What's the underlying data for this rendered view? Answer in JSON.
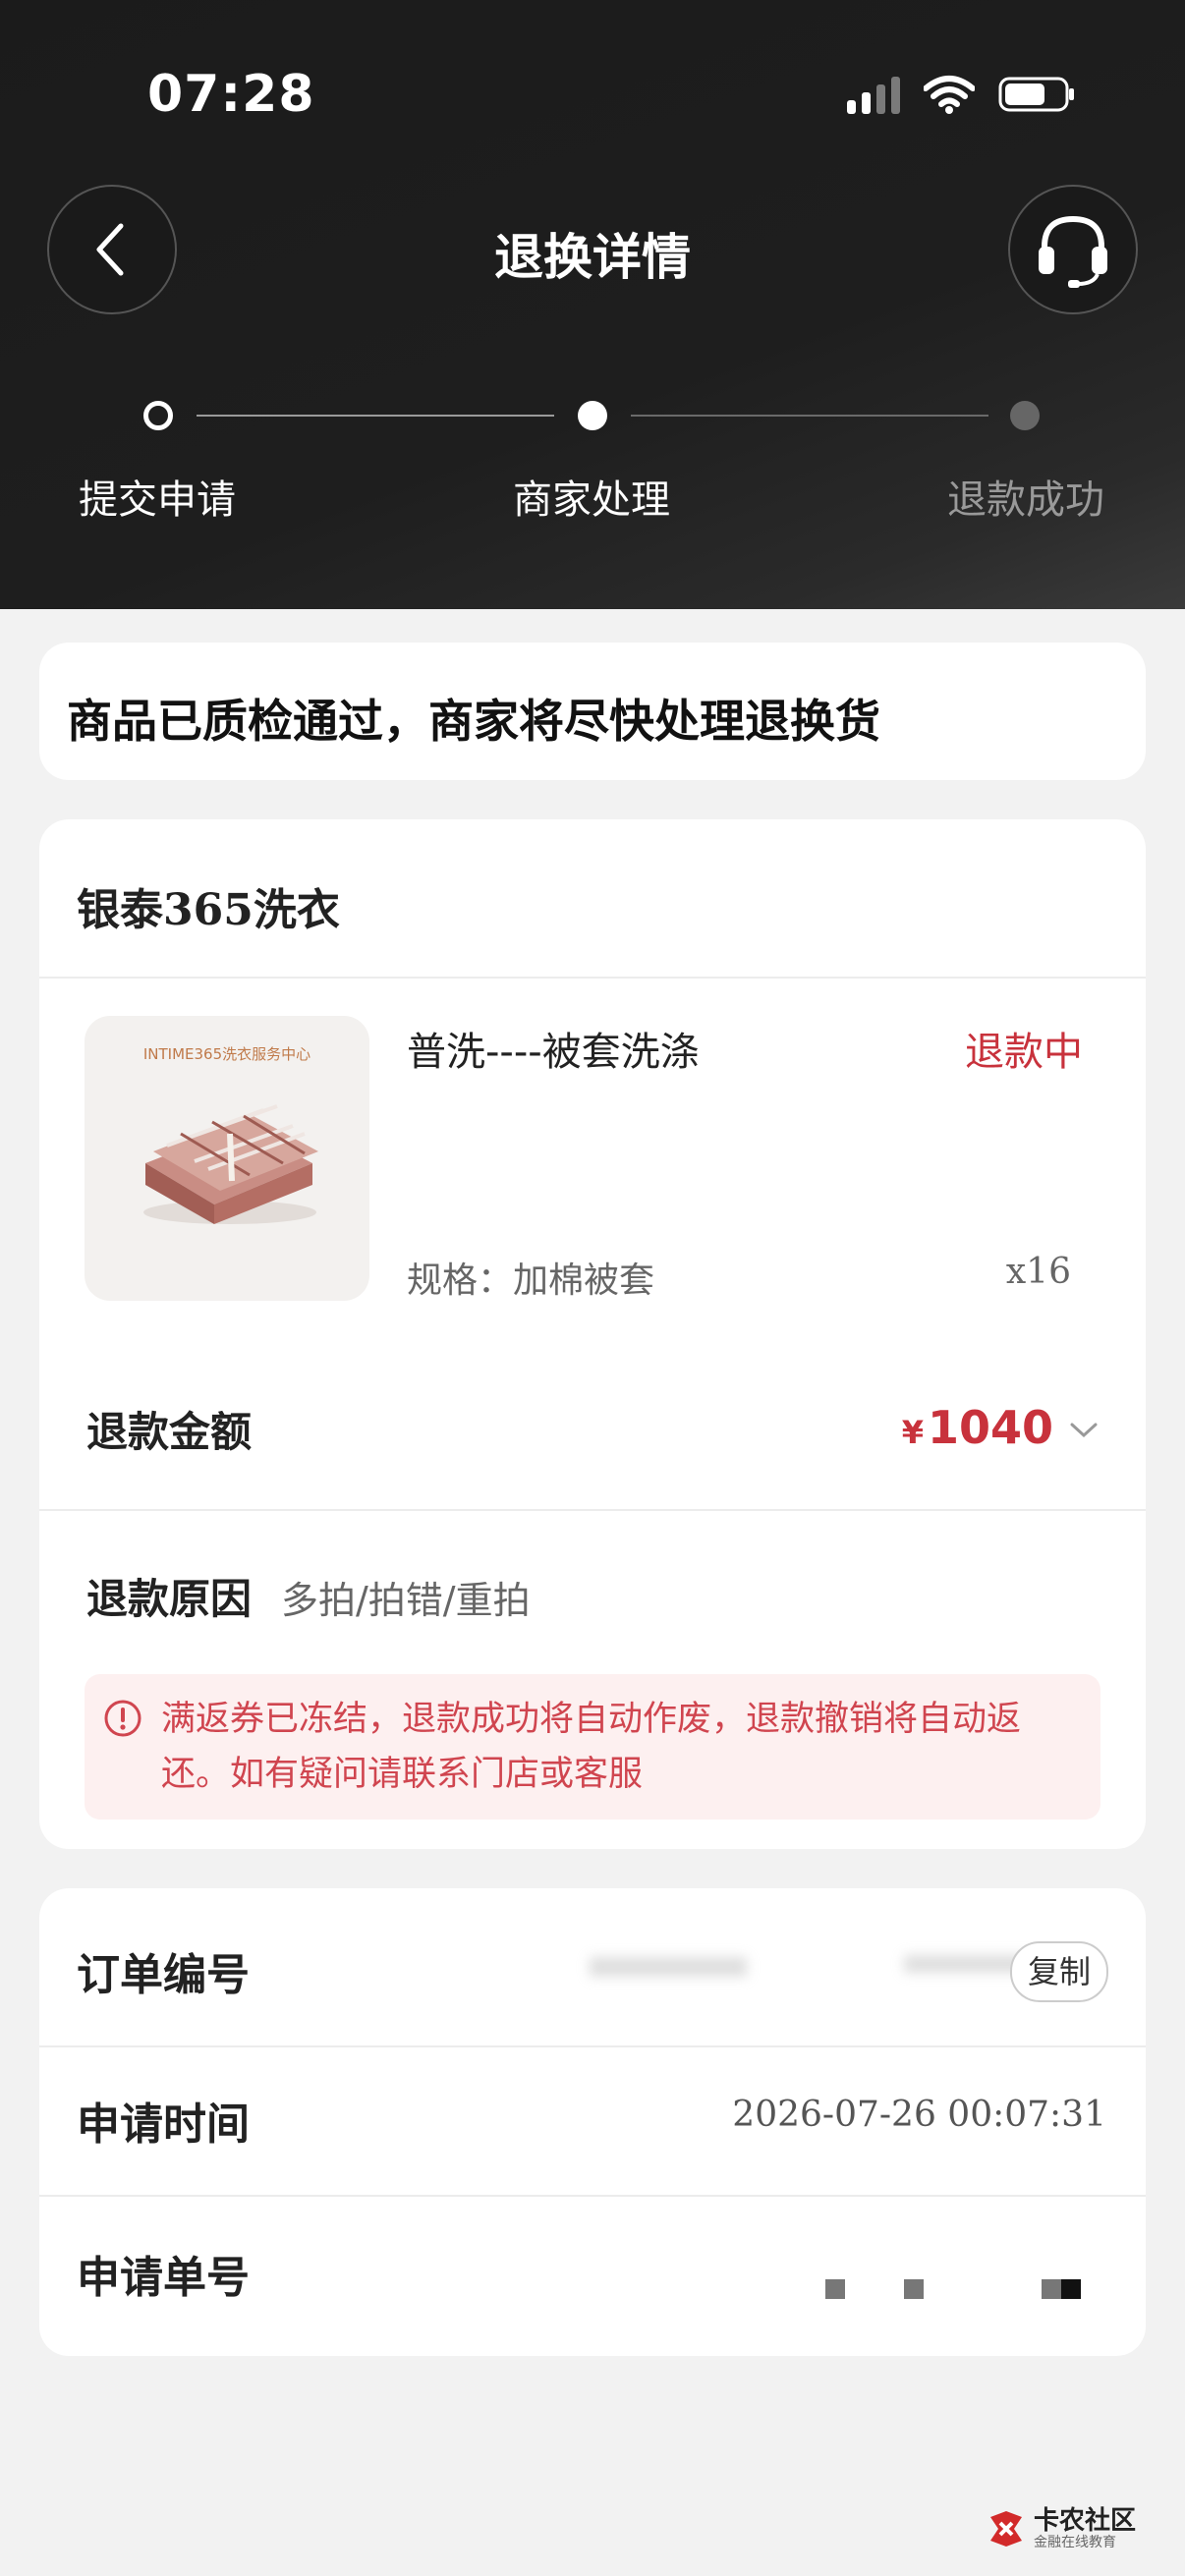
{
  "status_bar": {
    "time": "07:28"
  },
  "header": {
    "title": "退换详情"
  },
  "steps": [
    {
      "label": "提交申请"
    },
    {
      "label": "商家处理"
    },
    {
      "label": "退款成功"
    }
  ],
  "notice": {
    "text": "商品已质检通过，商家将尽快处理退换货"
  },
  "order_card": {
    "shop_name": "银泰365洗衣",
    "thumbnail_caption": "INTIME365洗衣服务中心",
    "product_title": "普洗----被套洗涤",
    "product_status": "退款中",
    "spec": "规格：加棉被套",
    "quantity": "x16",
    "refund_amount_label": "退款金额",
    "refund_currency": "¥",
    "refund_amount": "1040",
    "refund_reason_label": "退款原因",
    "refund_reason": "多拍/拍错/重拍",
    "warning_text": "满返券已冻结，退款成功将自动作废，退款撤销将自动返还。如有疑问请联系门店或客服"
  },
  "info_card": {
    "order_no_label": "订单编号",
    "copy_label": "复制",
    "apply_time_label": "申请时间",
    "apply_time": "2026-07-26 00:07:31",
    "apply_no_label": "申请单号"
  },
  "watermark": {
    "title": "卡农社区",
    "subtitle": "金融在线教育"
  },
  "colors": {
    "accent_red": "#c8323c",
    "header_bg": "#1c1c1c",
    "warning_bg": "#fdf0f0"
  }
}
